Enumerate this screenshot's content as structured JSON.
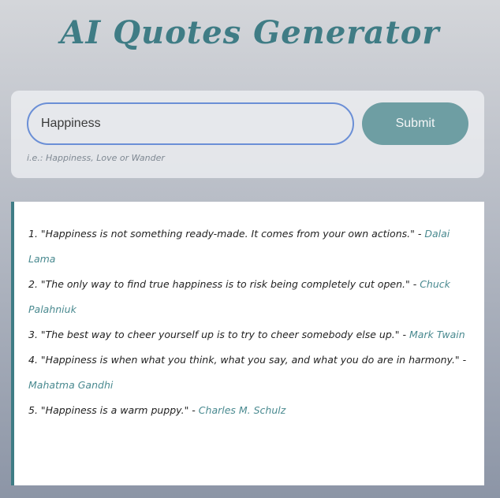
{
  "header": {
    "title": "AI Quotes Generator"
  },
  "form": {
    "input_value": "Happiness",
    "submit_label": "Submit",
    "hint": "i.e.: Happiness, Love or Wander"
  },
  "quotes": [
    {
      "number": "1.",
      "text": "\"Happiness is not something ready-made. It comes from your own actions.\"",
      "separator": " - ",
      "author": "Dalai Lama"
    },
    {
      "number": "2.",
      "text": "\"The only way to find true happiness is to risk being completely cut open.\"",
      "separator": " - ",
      "author": "Chuck Palahniuk"
    },
    {
      "number": "3.",
      "text": "\"The best way to cheer yourself up is to try to cheer somebody else up.\"",
      "separator": " - ",
      "author": "Mark Twain"
    },
    {
      "number": "4.",
      "text": "\"Happiness is when what you think, what you say, and what you do are in harmony.\"",
      "separator": " - ",
      "author": "Mahatma Gandhi"
    },
    {
      "number": "5.",
      "text": "\"Happiness is a warm puppy.\"",
      "separator": " - ",
      "author": "Charles M. Schulz"
    }
  ],
  "colors": {
    "accent": "#3f7c85",
    "button": "#6e9ea3",
    "input_border": "#6b8fd6"
  }
}
